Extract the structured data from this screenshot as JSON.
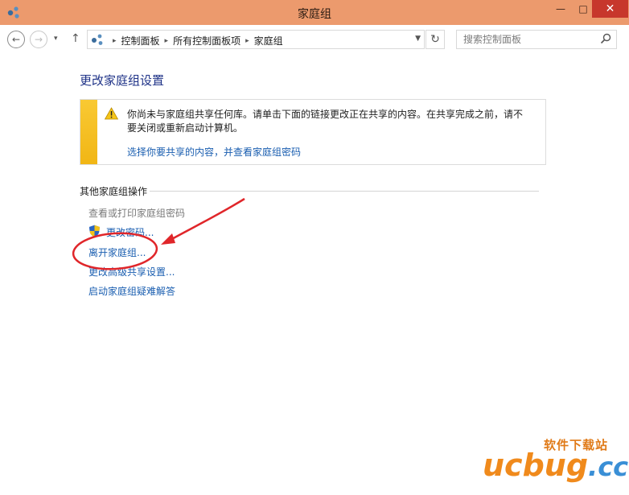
{
  "window": {
    "title": "家庭组"
  },
  "titlebar_buttons": {
    "minimize": "—",
    "maximize": "□",
    "close": "✕"
  },
  "nav": {
    "back": "←",
    "forward": "→",
    "recent": "▾",
    "up": "↑",
    "refresh": "↻"
  },
  "breadcrumbs": [
    "控制面板",
    "所有控制面板项",
    "家庭组"
  ],
  "search": {
    "placeholder": "搜索控制面板"
  },
  "main": {
    "title": "更改家庭组设置",
    "notice": {
      "text": "你尚未与家庭组共享任何库。请单击下面的链接更改正在共享的内容。在共享完成之前，请不要关闭或重新启动计算机。",
      "link": "选择你要共享的内容，并查看家庭组密码"
    },
    "section_title": "其他家庭组操作",
    "actions": [
      {
        "label": "查看或打印家庭组密码"
      },
      {
        "label": "更改密码..."
      },
      {
        "label": "离开家庭组..."
      },
      {
        "label": "更改高级共享设置..."
      },
      {
        "label": "启动家庭组疑难解答"
      }
    ]
  },
  "watermark": {
    "cn": "软件下载站",
    "en": "ucbug",
    "tld": ".cc"
  },
  "colors": {
    "titlebar": "#ec9a6d",
    "close": "#c7372c",
    "link": "#1a5eb0",
    "title": "#1e3287",
    "notice_bar": "#f4bd1f",
    "annotation": "#e0262a"
  }
}
